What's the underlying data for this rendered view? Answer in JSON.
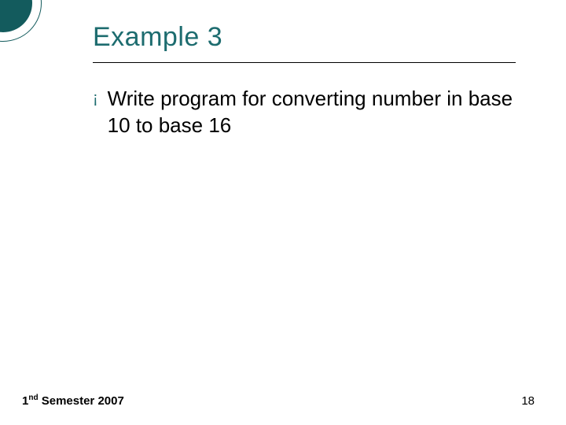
{
  "slide": {
    "title": "Example 3",
    "bullets": [
      {
        "marker": "¡",
        "text": "Write program for converting number in base 10 to base 16"
      }
    ]
  },
  "footer": {
    "semester_prefix": "1",
    "semester_suffix": "nd",
    "semester_rest": " Semester 2007",
    "page_number": "18"
  }
}
